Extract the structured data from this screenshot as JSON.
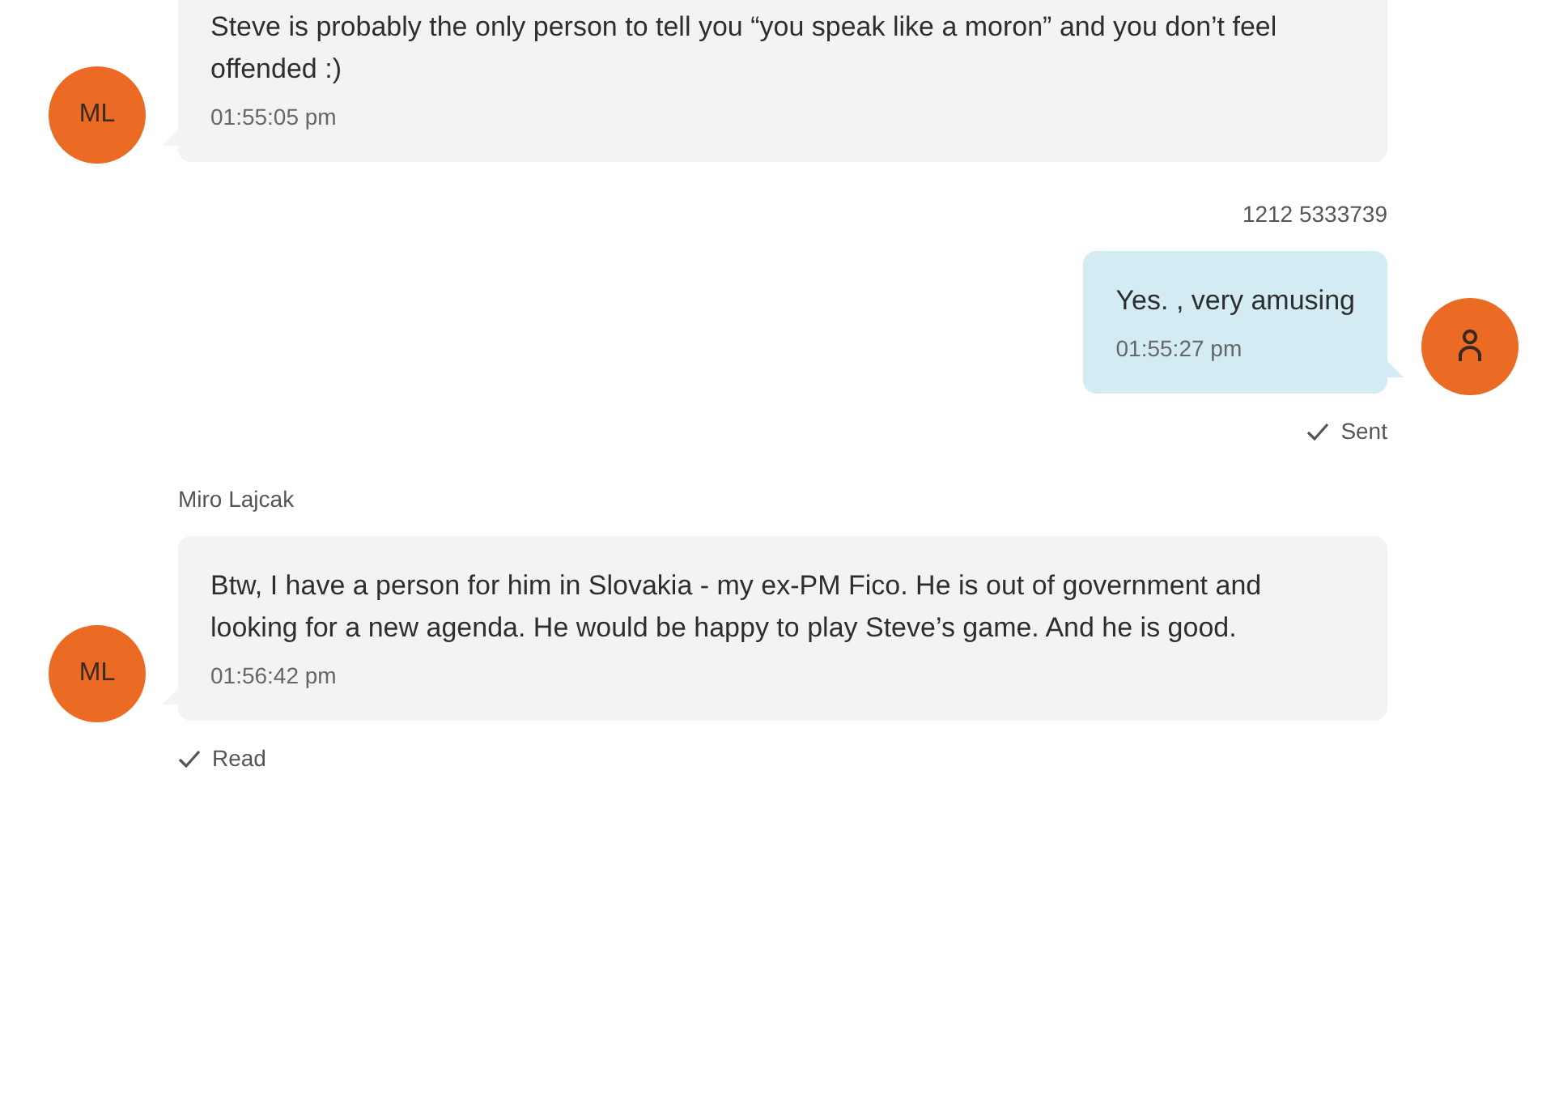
{
  "messages": [
    {
      "kind": "incoming",
      "avatar": {
        "kind": "initials",
        "text": "ML"
      },
      "text": "Steve is probably the only person to tell you “you speak like a moron” and you don’t feel offended :)",
      "time": "01:55:05 pm"
    },
    {
      "kind": "outgoing",
      "sender": "1212 5333739",
      "avatar": {
        "kind": "person"
      },
      "text": "Yes. , very amusing",
      "time": "01:55:27 pm",
      "status": "Sent"
    },
    {
      "kind": "incoming",
      "sender": "Miro Lajcak",
      "avatar": {
        "kind": "initials",
        "text": "ML"
      },
      "text": "Btw, I have a person for him in Slovakia - my ex-PM Fico. He is out of government and looking for a new agenda. He would be happy to play Steve’s game. And he is good.",
      "time": "01:56:42 pm",
      "status": "Read"
    }
  ]
}
